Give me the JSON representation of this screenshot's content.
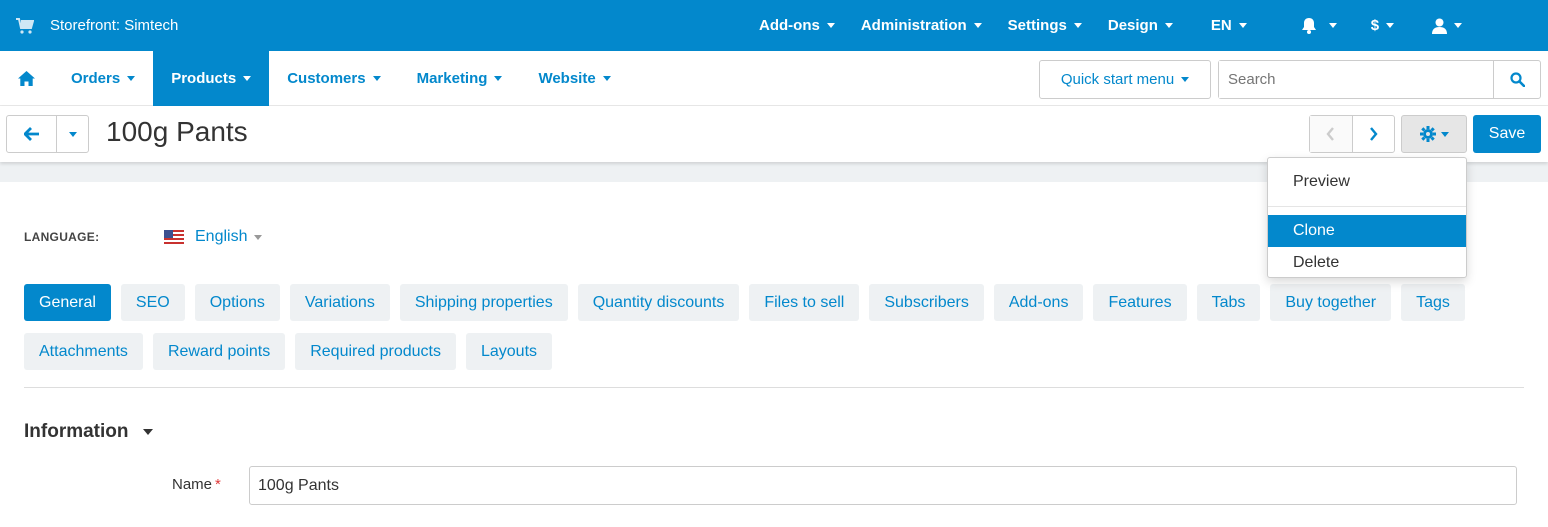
{
  "topbar": {
    "brand": "Storefront: Simtech",
    "menu": [
      {
        "label": "Add-ons"
      },
      {
        "label": "Administration"
      },
      {
        "label": "Settings"
      },
      {
        "label": "Design"
      },
      {
        "label": "EN"
      }
    ],
    "icons": [
      "bell-icon",
      "dollar-icon",
      "user-icon"
    ],
    "currency_symbol": "$"
  },
  "secondary_nav": {
    "items": [
      {
        "label": "Orders"
      },
      {
        "label": "Products",
        "active": true
      },
      {
        "label": "Customers"
      },
      {
        "label": "Marketing"
      },
      {
        "label": "Website"
      }
    ],
    "quick_start": "Quick start menu",
    "search_placeholder": "Search"
  },
  "titlebar": {
    "title": "100g Pants",
    "save_label": "Save"
  },
  "gear_dropdown": {
    "items": [
      {
        "label": "Preview"
      },
      {
        "label": "Clone",
        "active": true
      },
      {
        "label": "Delete"
      }
    ]
  },
  "language": {
    "label": "LANGUAGE:",
    "value": "English"
  },
  "tabs": {
    "row1": [
      "General",
      "SEO",
      "Options",
      "Variations",
      "Shipping properties",
      "Quantity discounts",
      "Files to sell",
      "Subscribers",
      "Add-ons",
      "Features",
      "Tabs",
      "Buy together",
      "Tags"
    ],
    "row2": [
      "Attachments",
      "Reward points",
      "Required products",
      "Layouts"
    ],
    "active": "General"
  },
  "information": {
    "heading": "Information",
    "name_label": "Name",
    "required_mark": "*",
    "name_value": "100g Pants"
  },
  "colors": {
    "primary": "#0388cc",
    "tab_bg": "#eef1f3",
    "required": "#e03a3a"
  }
}
